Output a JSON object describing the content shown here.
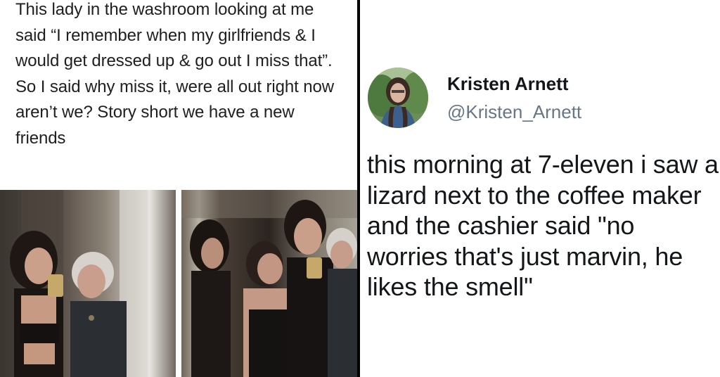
{
  "left_post": {
    "text": "This lady in the washroom looking at me said “I remember when my girlfriends & I would get dressed up & go out I miss that”. So I said why miss it, were all out right now aren’t we? Story short we have a new friends"
  },
  "tweet": {
    "display_name": "Kristen Arnett",
    "handle": "@Kristen_Arnett",
    "text": "this morning at 7-eleven i saw a lizard next to the coffee maker and the cashier said \"no worries that's just marvin, he likes the smell\""
  },
  "colors": {
    "name": "#14171a",
    "handle": "#657786",
    "post_text": "#1f1f1f"
  }
}
